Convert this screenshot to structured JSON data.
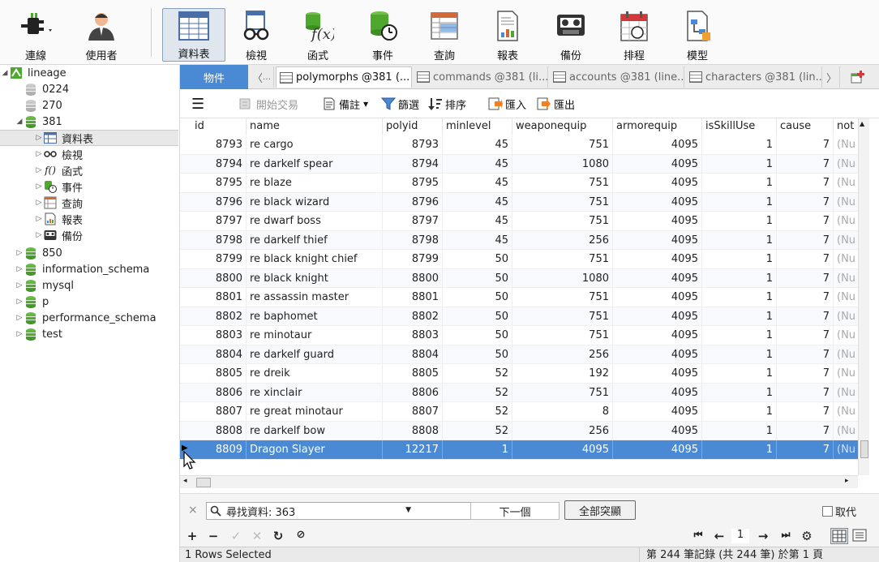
{
  "toolbar": {
    "items": [
      {
        "name": "connect",
        "label": "連線",
        "icon": "plug-icon"
      },
      {
        "name": "user",
        "label": "使用者",
        "icon": "user-icon"
      },
      {
        "name": "table",
        "label": "資料表",
        "icon": "table-icon",
        "active": true
      },
      {
        "name": "view",
        "label": "檢視",
        "icon": "glasses-icon"
      },
      {
        "name": "function",
        "label": "函式",
        "icon": "function-icon"
      },
      {
        "name": "event",
        "label": "事件",
        "icon": "clock-db-icon"
      },
      {
        "name": "query",
        "label": "查詢",
        "icon": "query-grid-icon"
      },
      {
        "name": "report",
        "label": "報表",
        "icon": "report-icon"
      },
      {
        "name": "backup",
        "label": "備份",
        "icon": "tape-icon"
      },
      {
        "name": "schedule",
        "label": "排程",
        "icon": "calendar-icon"
      },
      {
        "name": "model",
        "label": "模型",
        "icon": "model-icon"
      }
    ]
  },
  "sidebar": {
    "root": "lineage",
    "dbs_top": [
      "0224",
      "270",
      "381"
    ],
    "children_381": [
      {
        "label": "資料表",
        "icon": "table-icon"
      },
      {
        "label": "檢視",
        "icon": "glasses-icon"
      },
      {
        "label": "函式",
        "icon": "function-icon"
      },
      {
        "label": "事件",
        "icon": "clock-db-icon"
      },
      {
        "label": "查詢",
        "icon": "query-grid-icon"
      },
      {
        "label": "報表",
        "icon": "report-icon"
      },
      {
        "label": "備份",
        "icon": "tape-icon"
      }
    ],
    "dbs_bottom": [
      "850",
      "information_schema",
      "mysql",
      "p",
      "performance_schema",
      "test"
    ]
  },
  "tabs": {
    "objects": "物件",
    "items": [
      "polymorphs @381 (...",
      "commands @381 (li...",
      "accounts @381 (line...",
      "characters @381 (lin..."
    ]
  },
  "objbar": {
    "begin_tx": "開始交易",
    "memo": "備註",
    "filter": "篩選",
    "sort": "排序",
    "import": "匯入",
    "export": "匯出"
  },
  "grid": {
    "columns": [
      "id",
      "name",
      "polyid",
      "minlevel",
      "weaponequip",
      "armorequip",
      "isSkillUse",
      "cause",
      "not"
    ],
    "null_text": "(Nu",
    "rows": [
      [
        "8793",
        "re cargo",
        "8793",
        "45",
        "751",
        "4095",
        "1",
        "7"
      ],
      [
        "8794",
        "re darkelf spear",
        "8794",
        "45",
        "1080",
        "4095",
        "1",
        "7"
      ],
      [
        "8795",
        "re blaze",
        "8795",
        "45",
        "751",
        "4095",
        "1",
        "7"
      ],
      [
        "8796",
        "re black wizard",
        "8796",
        "45",
        "751",
        "4095",
        "1",
        "7"
      ],
      [
        "8797",
        "re dwarf boss",
        "8797",
        "45",
        "751",
        "4095",
        "1",
        "7"
      ],
      [
        "8798",
        "re darkelf thief",
        "8798",
        "45",
        "256",
        "4095",
        "1",
        "7"
      ],
      [
        "8799",
        "re black knight chief",
        "8799",
        "50",
        "751",
        "4095",
        "1",
        "7"
      ],
      [
        "8800",
        "re black knight",
        "8800",
        "50",
        "1080",
        "4095",
        "1",
        "7"
      ],
      [
        "8801",
        "re assassin master",
        "8801",
        "50",
        "751",
        "4095",
        "1",
        "7"
      ],
      [
        "8802",
        "re baphomet",
        "8802",
        "50",
        "751",
        "4095",
        "1",
        "7"
      ],
      [
        "8803",
        "re minotaur",
        "8803",
        "50",
        "751",
        "4095",
        "1",
        "7"
      ],
      [
        "8804",
        "re darkelf guard",
        "8804",
        "50",
        "256",
        "4095",
        "1",
        "7"
      ],
      [
        "8805",
        "re dreik",
        "8805",
        "52",
        "192",
        "4095",
        "1",
        "7"
      ],
      [
        "8806",
        "re xinclair",
        "8806",
        "52",
        "751",
        "4095",
        "1",
        "7"
      ],
      [
        "8807",
        "re great minotaur",
        "8807",
        "52",
        "8",
        "4095",
        "1",
        "7"
      ],
      [
        "8808",
        "re darkelf bow",
        "8808",
        "52",
        "256",
        "4095",
        "1",
        "7"
      ],
      [
        "8809",
        "Dragon Slayer",
        "12217",
        "1",
        "4095",
        "4095",
        "1",
        "7"
      ]
    ],
    "selected_row": 16
  },
  "findbar": {
    "search_value": "尋找資料: 363",
    "next": "下一個",
    "highlight_all": "全部突顯",
    "replace": "取代"
  },
  "editbar": {
    "page": "1"
  },
  "status": {
    "left": "1 Rows Selected",
    "right": "第 244 筆記錄 (共 244 筆) 於第 1 頁"
  },
  "colors": {
    "accent": "#4a8ad4",
    "db_green": "#4ea82e"
  }
}
